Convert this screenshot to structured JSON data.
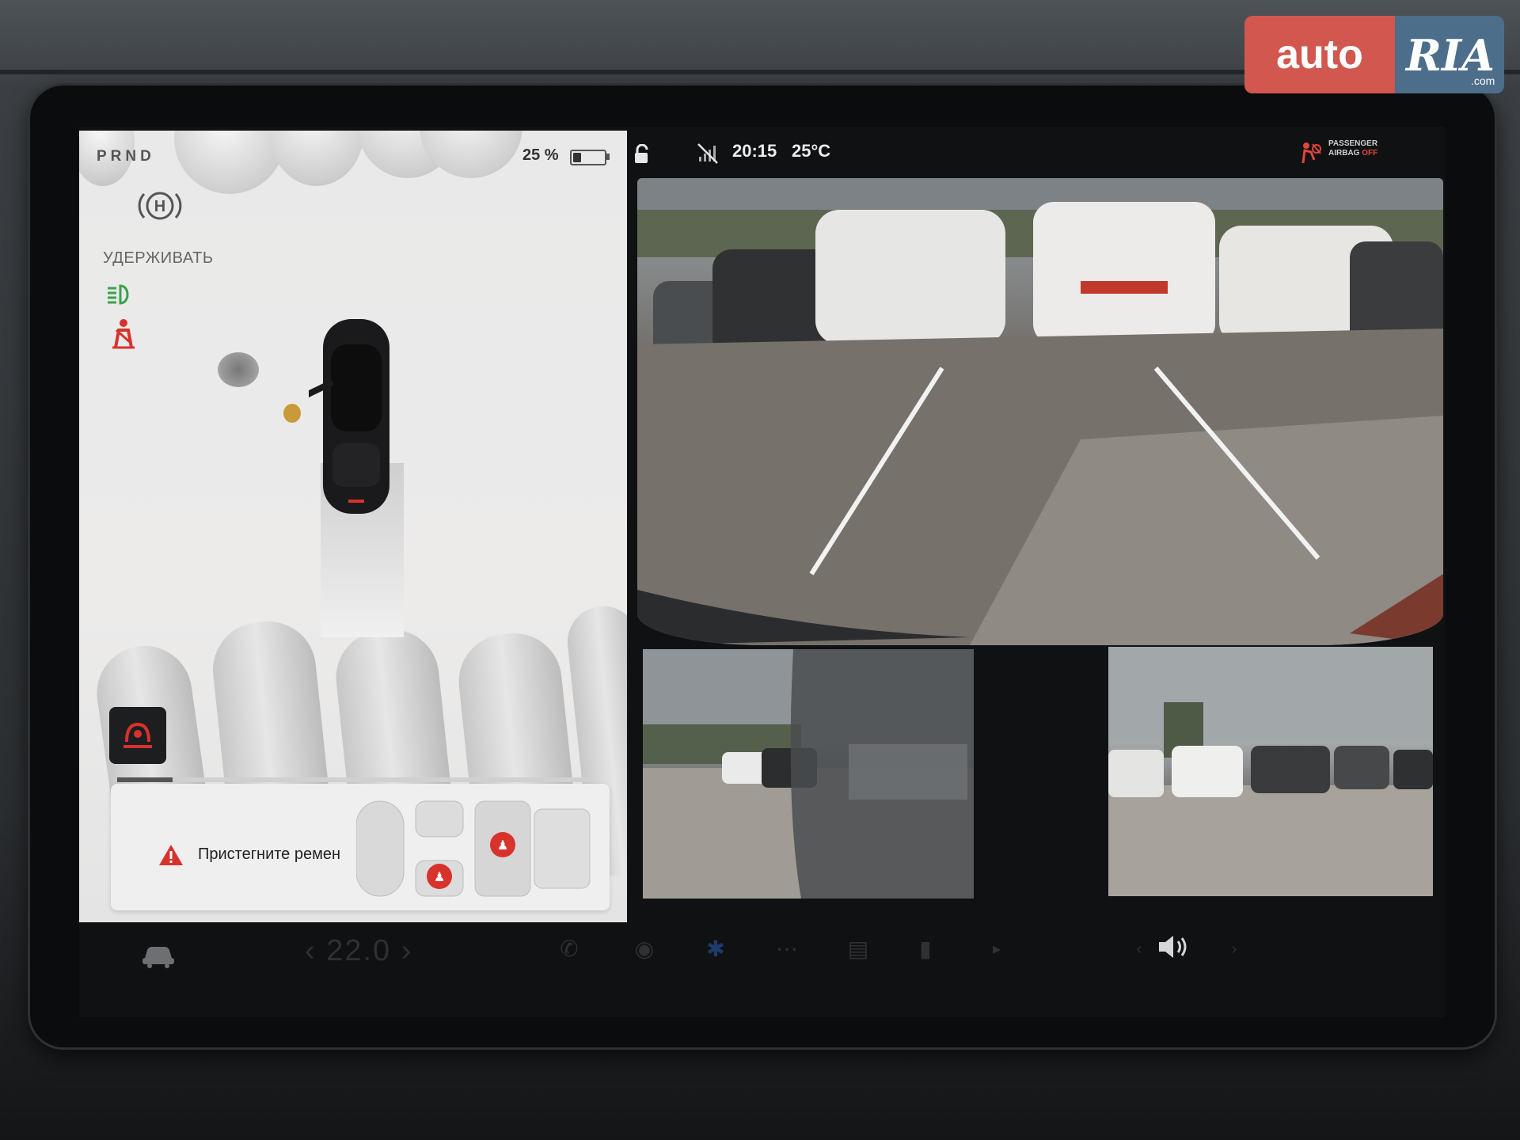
{
  "left_panel": {
    "gear": "PRND",
    "battery_percent": "25 %",
    "battery_level": 0.25,
    "hold_label": "УДЕРЖИВАТЬ",
    "alert_text": "Пристегните ремен",
    "icons": [
      "parking-hold-icon",
      "headlights-icon",
      "seatbelt-warning-icon",
      "seat-occupancy-icon",
      "warning-triangle-icon"
    ]
  },
  "status_bar": {
    "time": "20:15",
    "temperature": "25°C",
    "airbag_line1": "PASSENGER",
    "airbag_line2_a": "AIRBAG ",
    "airbag_line2_b": "OFF"
  },
  "dock": {
    "cabin_temp": "‹ 22.0 ›"
  },
  "watermark": {
    "brand_a": "auto",
    "brand_b": "RIA",
    "brand_tld": ".com"
  },
  "colors": {
    "alert_red": "#d8322c",
    "panel_bg": "#ebebeb",
    "screen_bg": "#101113",
    "watermark_red": "#d2574e",
    "watermark_blue": "#4d6e8b"
  }
}
